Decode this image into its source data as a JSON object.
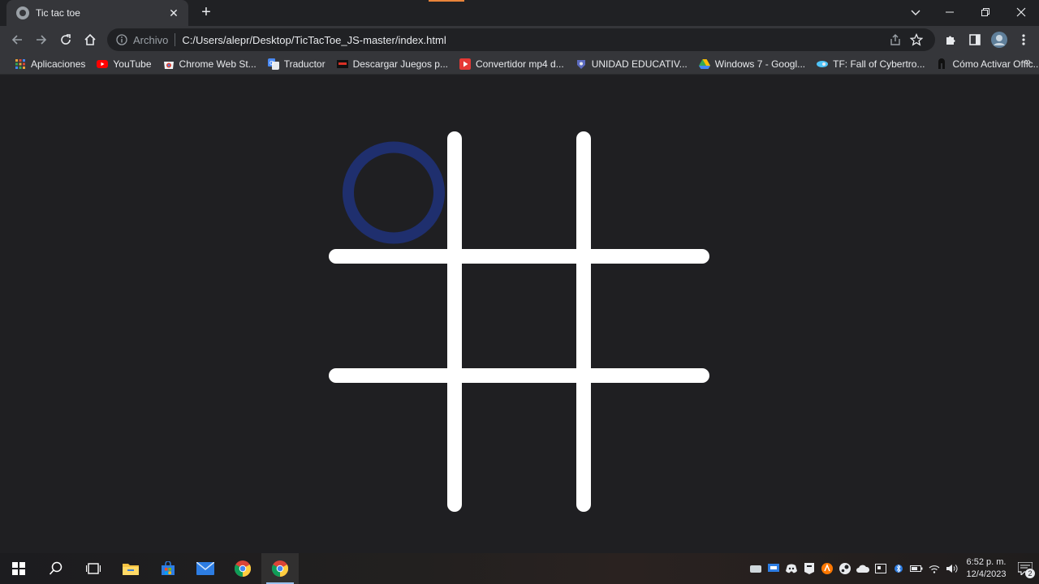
{
  "browser": {
    "tab": {
      "title": "Tic tac toe",
      "close": "✕"
    },
    "new_tab": "+",
    "address": {
      "scheme_label": "Archivo",
      "url": "C:/Users/alepr/Desktop/TicTacToe_JS-master/index.html"
    },
    "bookmarks": [
      {
        "label": "Aplicaciones",
        "icon": "apps-grid-icon",
        "color": "#e8a33a"
      },
      {
        "label": "YouTube",
        "icon": "youtube-icon",
        "color": "#ff0000"
      },
      {
        "label": "Chrome Web St...",
        "icon": "chrome-web-store-icon",
        "color": "#db4437"
      },
      {
        "label": "Traductor",
        "icon": "translate-icon",
        "color": "#4a8af4"
      },
      {
        "label": "Descargar Juegos p...",
        "icon": "games-site-icon",
        "color": "#d93025"
      },
      {
        "label": "Convertidor mp4 d...",
        "icon": "play-icon",
        "color": "#e53935"
      },
      {
        "label": "UNIDAD EDUCATIV...",
        "icon": "school-crest-icon",
        "color": "#5c6bc0"
      },
      {
        "label": "Windows 7 - Googl...",
        "icon": "drive-icon",
        "color": "#34a853"
      },
      {
        "label": "TF: Fall of Cybertro...",
        "icon": "cybertron-icon",
        "color": "#4fc3f7"
      },
      {
        "label": "Cómo Activar Offic...",
        "icon": "office-icon",
        "color": "#9e9e9e"
      }
    ],
    "bookmarks_more": "»"
  },
  "game": {
    "marks": [
      {
        "cell": 0,
        "symbol": "O",
        "color": "#1f2f6e"
      }
    ],
    "grid_color": "#ffffff"
  },
  "taskbar": {
    "clock_time": "6:52 p. m.",
    "clock_date": "12/4/2023",
    "notification_count": "2"
  }
}
